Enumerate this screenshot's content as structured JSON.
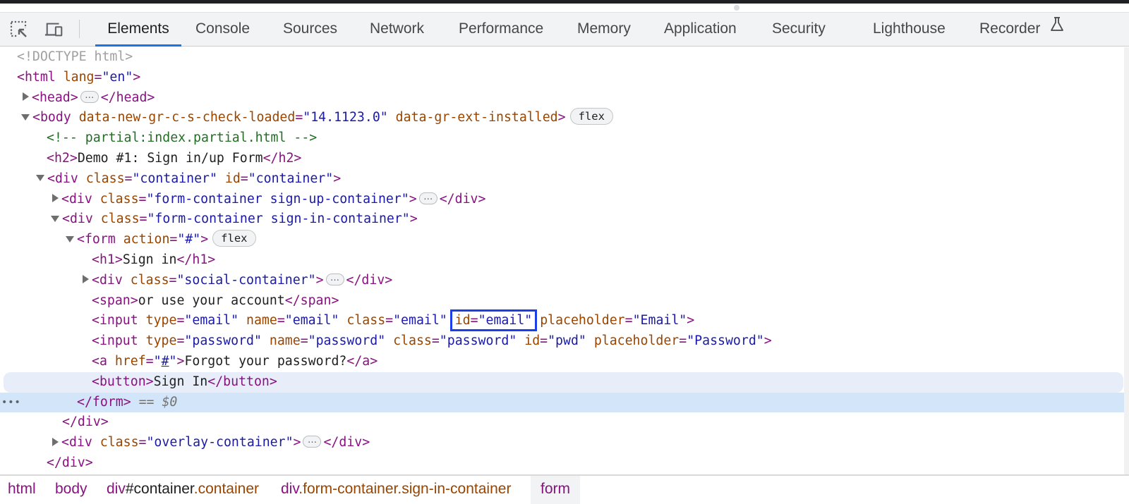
{
  "toolbar": {
    "icons": [
      {
        "name": "inspect-element-icon"
      },
      {
        "name": "device-toolbar-icon"
      }
    ],
    "tabs": [
      {
        "label": "Elements",
        "active": true
      },
      {
        "label": "Console"
      },
      {
        "label": "Sources"
      },
      {
        "label": "Network"
      },
      {
        "label": "Performance"
      },
      {
        "label": "Memory"
      },
      {
        "label": "Application"
      },
      {
        "label": "Security"
      },
      {
        "label": "Lighthouse"
      },
      {
        "label": "Recorder",
        "icon": "flask-icon"
      }
    ]
  },
  "dom_tree": {
    "doctype": "<!DOCTYPE html>",
    "html_open": {
      "tag": "<html",
      "attr": "lang",
      "value": "\"en\"",
      "close": ">"
    },
    "head": {
      "open": "<head>",
      "close": "</head>"
    },
    "body": {
      "tag": "<body",
      "attr1": "data-new-gr-c-s-check-loaded",
      "value1": "\"14.1123.0\"",
      "attr2": "data-gr-ext-installed",
      "close": ">",
      "badge": "flex"
    },
    "comment": "<!-- partial:index.partial.html -->",
    "h2": {
      "open": "<h2>",
      "text": "Demo #1: Sign in/up Form",
      "close": "</h2>"
    },
    "container": {
      "tag": "<div",
      "attr1": "class",
      "value1": "\"container\"",
      "attr2": "id",
      "value2": "\"container\"",
      "close": ">"
    },
    "signup": {
      "tag": "<div",
      "attr": "class",
      "value": "\"form-container sign-up-container\"",
      "close": ">",
      "end": "</div>"
    },
    "signin": {
      "tag": "<div",
      "attr": "class",
      "value": "\"form-container sign-in-container\"",
      "close": ">"
    },
    "form": {
      "tag": "<form",
      "attr": "action",
      "value": "\"#\"",
      "close": ">",
      "badge": "flex"
    },
    "h1": {
      "open": "<h1>",
      "text": "Sign in",
      "close": "</h1>"
    },
    "social": {
      "tag": "<div",
      "attr": "class",
      "value": "\"social-container\"",
      "close": ">",
      "end": "</div>"
    },
    "span": {
      "open": "<span>",
      "text": "or use your account",
      "close": "</span>"
    },
    "input_email": {
      "tag": "<input",
      "a1": "type",
      "v1": "\"email\"",
      "a2": "name",
      "v2": "\"email\"",
      "a3": "class",
      "v3": "\"email\"",
      "a4": "id",
      "v4": "\"email\"",
      "a5": "placeholder",
      "v5": "\"Email\"",
      "close": ">"
    },
    "input_password": {
      "tag": "<input",
      "a1": "type",
      "v1": "\"password\"",
      "a2": "name",
      "v2": "\"password\"",
      "a3": "class",
      "v3": "\"password\"",
      "a4": "id",
      "v4": "\"pwd\"",
      "a5": "placeholder",
      "v5": "\"Password\"",
      "close": ">"
    },
    "anchor": {
      "tag": "<a",
      "attr": "href",
      "q1": "\"",
      "link": "#",
      "q2": "\"",
      "close": ">",
      "text": "Forgot your password?",
      "end": "</a>"
    },
    "button": {
      "open": "<button>",
      "text": "Sign In",
      "close": "</button>"
    },
    "form_close": {
      "tag": "</form>",
      "eq": "==",
      "ref": "$0"
    },
    "div_close": "</div>",
    "overlay": {
      "tag": "<div",
      "attr": "class",
      "value": "\"overlay-container\"",
      "close": ">",
      "end": "</div>"
    },
    "container_close": "</div>"
  },
  "breadcrumbs": [
    {
      "tag": "html"
    },
    {
      "tag": "body"
    },
    {
      "tag": "div",
      "id": "#container",
      "cls": ".container"
    },
    {
      "tag": "div",
      "cls": ".form-container.sign-in-container"
    },
    {
      "tag": "form",
      "active": true
    }
  ],
  "colors": {
    "accent": "#1a73e8",
    "tag": "#881280",
    "attr_name": "#994500",
    "attr_value": "#1a1aa6",
    "comment": "#236e25",
    "selected_row": "#d2e5f9",
    "highlight_box": "#1b3fe6"
  }
}
